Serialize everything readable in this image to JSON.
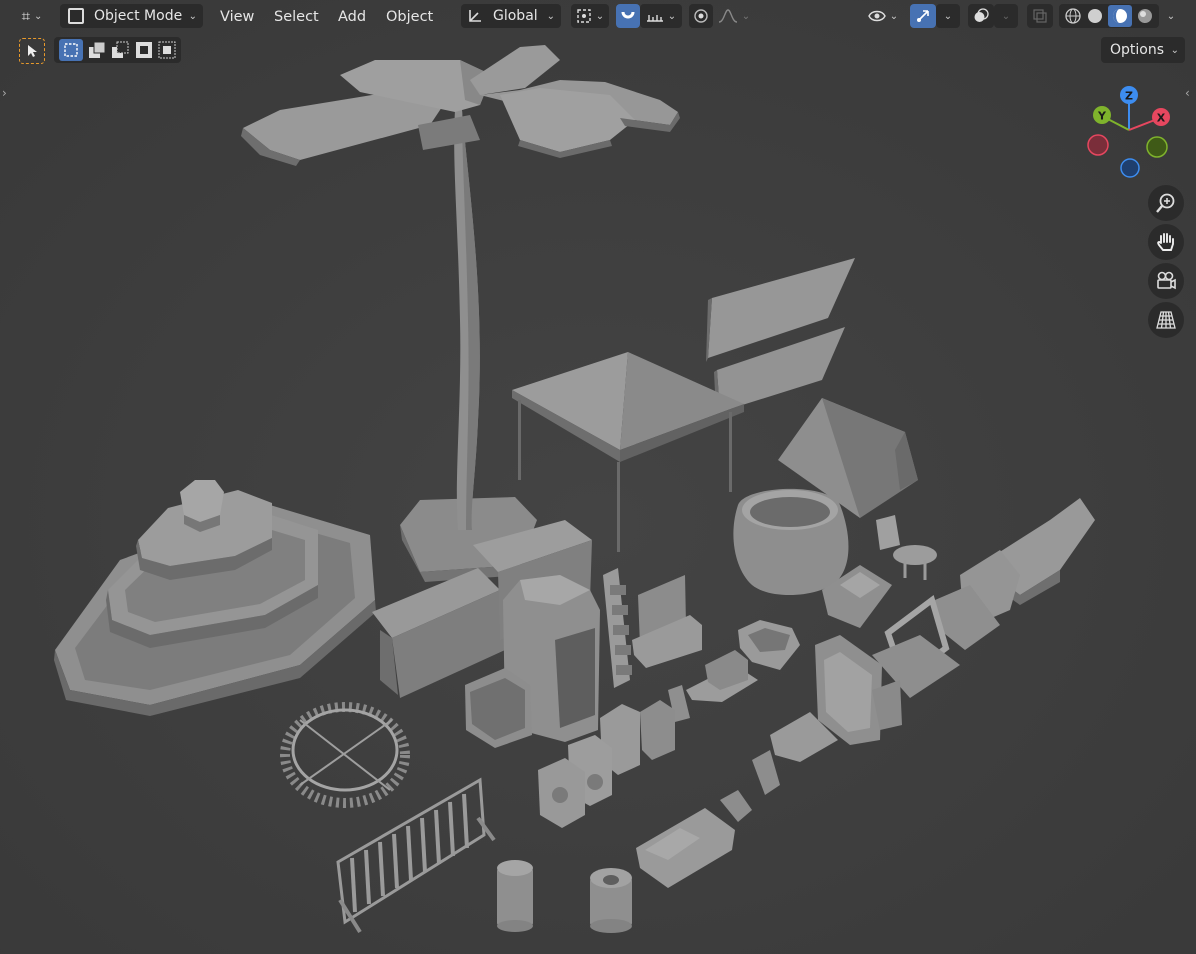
{
  "header": {
    "mode": {
      "label": "Object Mode",
      "icon": "object-mode-icon"
    },
    "menus": [
      {
        "label": "View"
      },
      {
        "label": "Select"
      },
      {
        "label": "Add"
      },
      {
        "label": "Object"
      }
    ],
    "orientation": {
      "label": "Global",
      "icon": "transform-orientation-icon"
    },
    "options_label": "Options"
  },
  "gizmo": {
    "x_label": "X",
    "y_label": "Y",
    "z_label": "Z",
    "x_color": "#e6475f",
    "y_color": "#7fb32c",
    "z_color": "#3d8df0"
  },
  "colors": {
    "viewport_bg": "#3e3e3e",
    "button_bg": "#2b2b2b",
    "active_blue": "#4772b3",
    "select_orange": "#e89a2c"
  },
  "nav_icons": [
    "zoom-icon",
    "hand-pan-icon",
    "camera-icon",
    "perspective-grid-icon"
  ]
}
